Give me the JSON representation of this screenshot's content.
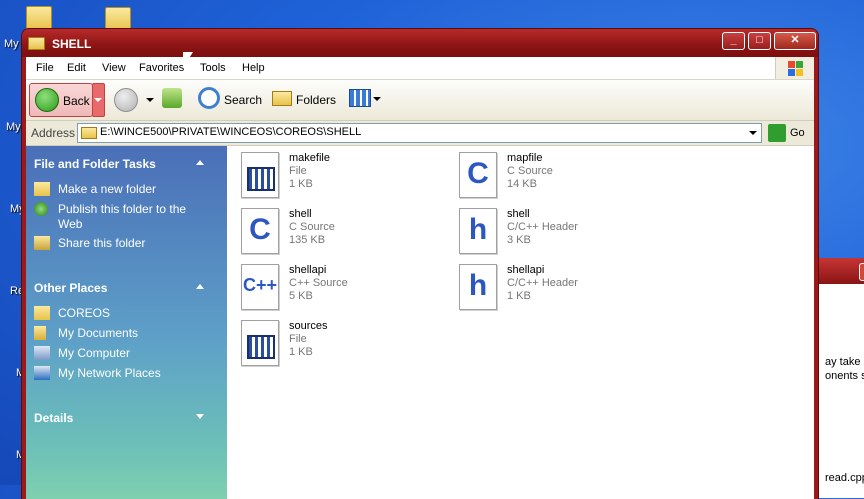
{
  "desktop": {
    "labels": [
      "My",
      "My",
      "My",
      "Re",
      "M",
      "M"
    ]
  },
  "background_window": {
    "lines": [
      "ay take s",
      "onents se",
      "read.cpp"
    ]
  },
  "window": {
    "title": "SHELL",
    "controls": {
      "minimize": "_",
      "maximize": "□",
      "close": "✕"
    }
  },
  "menu": [
    "File",
    "Edit",
    "View",
    "Favorites",
    "Tools",
    "Help"
  ],
  "toolbar": {
    "back": "Back",
    "search": "Search",
    "folders": "Folders"
  },
  "address": {
    "label": "Address",
    "path": "E:\\WINCE500\\PRIVATE\\WINCEOS\\COREOS\\SHELL",
    "go": "Go"
  },
  "taskpane": {
    "file_tasks": {
      "title": "File and Folder Tasks",
      "items": [
        {
          "label": "Make a new folder",
          "icon": "new-folder-icon"
        },
        {
          "label": "Publish this folder to the",
          "label2": "Web",
          "icon": "publish-web-icon"
        },
        {
          "label": "Share this folder",
          "icon": "share-folder-icon"
        }
      ]
    },
    "other_places": {
      "title": "Other Places",
      "items": [
        {
          "label": "COREOS",
          "icon": "folder-icon"
        },
        {
          "label": "My Documents",
          "icon": "my-documents-icon"
        },
        {
          "label": "My Computer",
          "icon": "my-computer-icon"
        },
        {
          "label": "My Network Places",
          "icon": "network-places-icon"
        }
      ]
    },
    "details": {
      "title": "Details"
    }
  },
  "files": [
    {
      "name": "makefile",
      "type": "File",
      "size": "1 KB",
      "icon": "generic-file-icon"
    },
    {
      "name": "mapfile",
      "type": "C Source",
      "size": "14 KB",
      "icon": "c-source-icon",
      "glyph": "C"
    },
    {
      "name": "shell",
      "type": "C Source",
      "size": "135 KB",
      "icon": "c-source-icon",
      "glyph": "C"
    },
    {
      "name": "shell",
      "type": "C/C++ Header",
      "size": "3 KB",
      "icon": "header-file-icon",
      "glyph": "h"
    },
    {
      "name": "shellapi",
      "type": "C++ Source",
      "size": "5 KB",
      "icon": "cpp-source-icon",
      "glyph": "C++"
    },
    {
      "name": "shellapi",
      "type": "C/C++ Header",
      "size": "1 KB",
      "icon": "header-file-icon",
      "glyph": "h"
    },
    {
      "name": "sources",
      "type": "File",
      "size": "1 KB",
      "icon": "generic-file-icon"
    }
  ],
  "colors": {
    "title_bar": "#8c1414",
    "task_pane": "#4a6fb8",
    "link_text": "#ffffff"
  }
}
